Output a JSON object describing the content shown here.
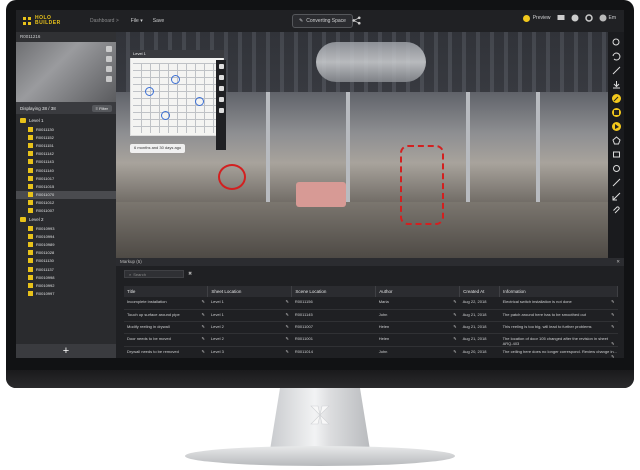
{
  "app": {
    "logo_top": "HOLO",
    "logo_bottom": "BUILDER",
    "breadcrumb": "Dashboard >",
    "file_menu": "File",
    "save": "Save",
    "center_button": "Converting Space",
    "preview": "Preview",
    "user": "Em"
  },
  "left": {
    "scene_title": "R0011216",
    "displaying": "Displaying 38 / 38",
    "filter": "Filter",
    "levels": [
      {
        "label": "Level 1",
        "scenes": [
          "R0011130",
          "R0011152",
          "R0011151",
          "R0011142",
          "R0011143",
          "R0011140",
          "R0011017",
          "R0011015",
          "R0011070",
          "R0011012",
          "R0011007"
        ]
      },
      {
        "label": "Level 2",
        "scenes": [
          "R0010993",
          "R0010994",
          "R0010989",
          "R0011028",
          "R0011130",
          "R0011137",
          "R0010998",
          "R0010992",
          "R0010997"
        ]
      }
    ],
    "add": "+"
  },
  "viewer": {
    "minimap_title": "Level 1",
    "tooltip": "6 months and 30 days ago"
  },
  "issues": {
    "header": "Markup (5)",
    "search_placeholder": "Search",
    "columns": [
      "Title",
      "Sheet Location",
      "Scene Location",
      "Author",
      "Created At",
      "Information"
    ],
    "rows": [
      [
        "Incomplete installation",
        "Level 1",
        "R0011156",
        "Maria",
        "Aug 22, 2018",
        "Electrical switch installation is not done"
      ],
      [
        "Touch up surface around pipe",
        "Level 1",
        "R0011145",
        "John",
        "Aug 21, 2018",
        "The patch around here has to be smoothed out"
      ],
      [
        "Modify reeling in drywall",
        "Level 2",
        "R0011007",
        "Helen",
        "Aug 21, 2018",
        "This reeling is too big, will lead to further problems"
      ],
      [
        "Door needs to be moved",
        "Level 2",
        "R0011001",
        "Helen",
        "Aug 21, 2018",
        "The location of door 105 changed after the revision in sheet ARQ-403"
      ],
      [
        "Drywall needs to be removed",
        "Level 3",
        "R0011014",
        "John",
        "Aug 20, 2018",
        "The ceiling here does no longer correspond. Review change in..."
      ]
    ]
  }
}
